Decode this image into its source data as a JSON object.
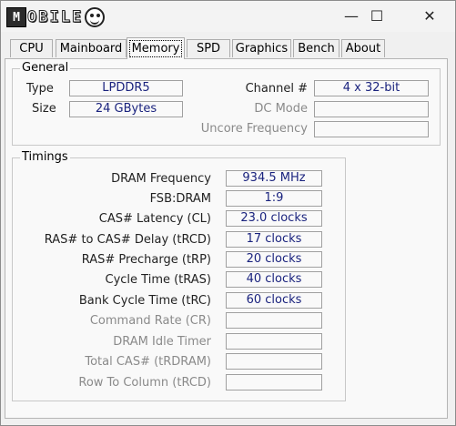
{
  "titlebar": {
    "logo_letter": "M",
    "logo_text": "OBILE",
    "minimize": "—",
    "maximize": "☐",
    "close": "✕"
  },
  "tabs": [
    {
      "label": "CPU"
    },
    {
      "label": "Mainboard"
    },
    {
      "label": "Memory"
    },
    {
      "label": "SPD"
    },
    {
      "label": "Graphics"
    },
    {
      "label": "Bench"
    },
    {
      "label": "About"
    }
  ],
  "general": {
    "title": "General",
    "type_label": "Type",
    "type_value": "LPDDR5",
    "size_label": "Size",
    "size_value": "24 GBytes",
    "channel_label": "Channel #",
    "channel_value": "4 x 32-bit",
    "dcmode_label": "DC Mode",
    "dcmode_value": "",
    "uncore_label": "Uncore Frequency",
    "uncore_value": ""
  },
  "timings": {
    "title": "Timings",
    "rows": [
      {
        "label": "DRAM Frequency",
        "value": "934.5 MHz"
      },
      {
        "label": "FSB:DRAM",
        "value": "1:9"
      },
      {
        "label": "CAS# Latency (CL)",
        "value": "23.0 clocks"
      },
      {
        "label": "RAS# to CAS# Delay (tRCD)",
        "value": "17 clocks"
      },
      {
        "label": "RAS# Precharge (tRP)",
        "value": "20 clocks"
      },
      {
        "label": "Cycle Time (tRAS)",
        "value": "40 clocks"
      },
      {
        "label": "Bank Cycle Time (tRC)",
        "value": "60 clocks"
      },
      {
        "label": "Command Rate (CR)",
        "value": ""
      },
      {
        "label": "DRAM Idle Timer",
        "value": ""
      },
      {
        "label": "Total CAS# (tRDRAM)",
        "value": ""
      },
      {
        "label": "Row To Column (tRCD)",
        "value": ""
      }
    ]
  }
}
